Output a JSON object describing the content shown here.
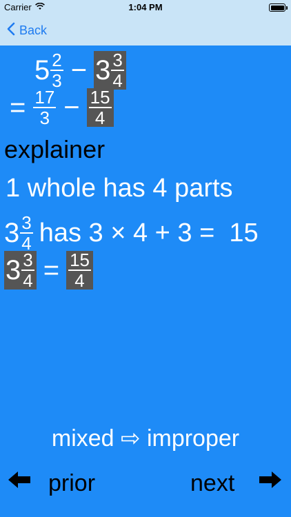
{
  "status": {
    "carrier": "Carrier",
    "time": "1:04 PM"
  },
  "nav": {
    "back_label": "Back"
  },
  "problem": {
    "mixed1": {
      "whole": "5",
      "num": "2",
      "den": "3"
    },
    "minus": "−",
    "mixed2": {
      "whole": "3",
      "num": "3",
      "den": "4"
    },
    "equals": "=",
    "improper1": {
      "num": "17",
      "den": "3"
    },
    "improper2": {
      "num": "15",
      "den": "4"
    }
  },
  "explainer": {
    "title": "explainer",
    "line1": "1 whole has 4 parts",
    "line2_mixed": {
      "whole": "3",
      "num": "3",
      "den": "4"
    },
    "line2_text": "has 3 × 4 + 3 =  15",
    "line3_mixed": {
      "whole": "3",
      "num": "3",
      "den": "4"
    },
    "line3_eq": "=",
    "line3_improper": {
      "num": "15",
      "den": "4"
    }
  },
  "footer": {
    "title": "mixed ⇨ improper",
    "prior_label": "prior",
    "next_label": "next",
    "prior_arrow": "🡄",
    "next_arrow": "🡆"
  }
}
